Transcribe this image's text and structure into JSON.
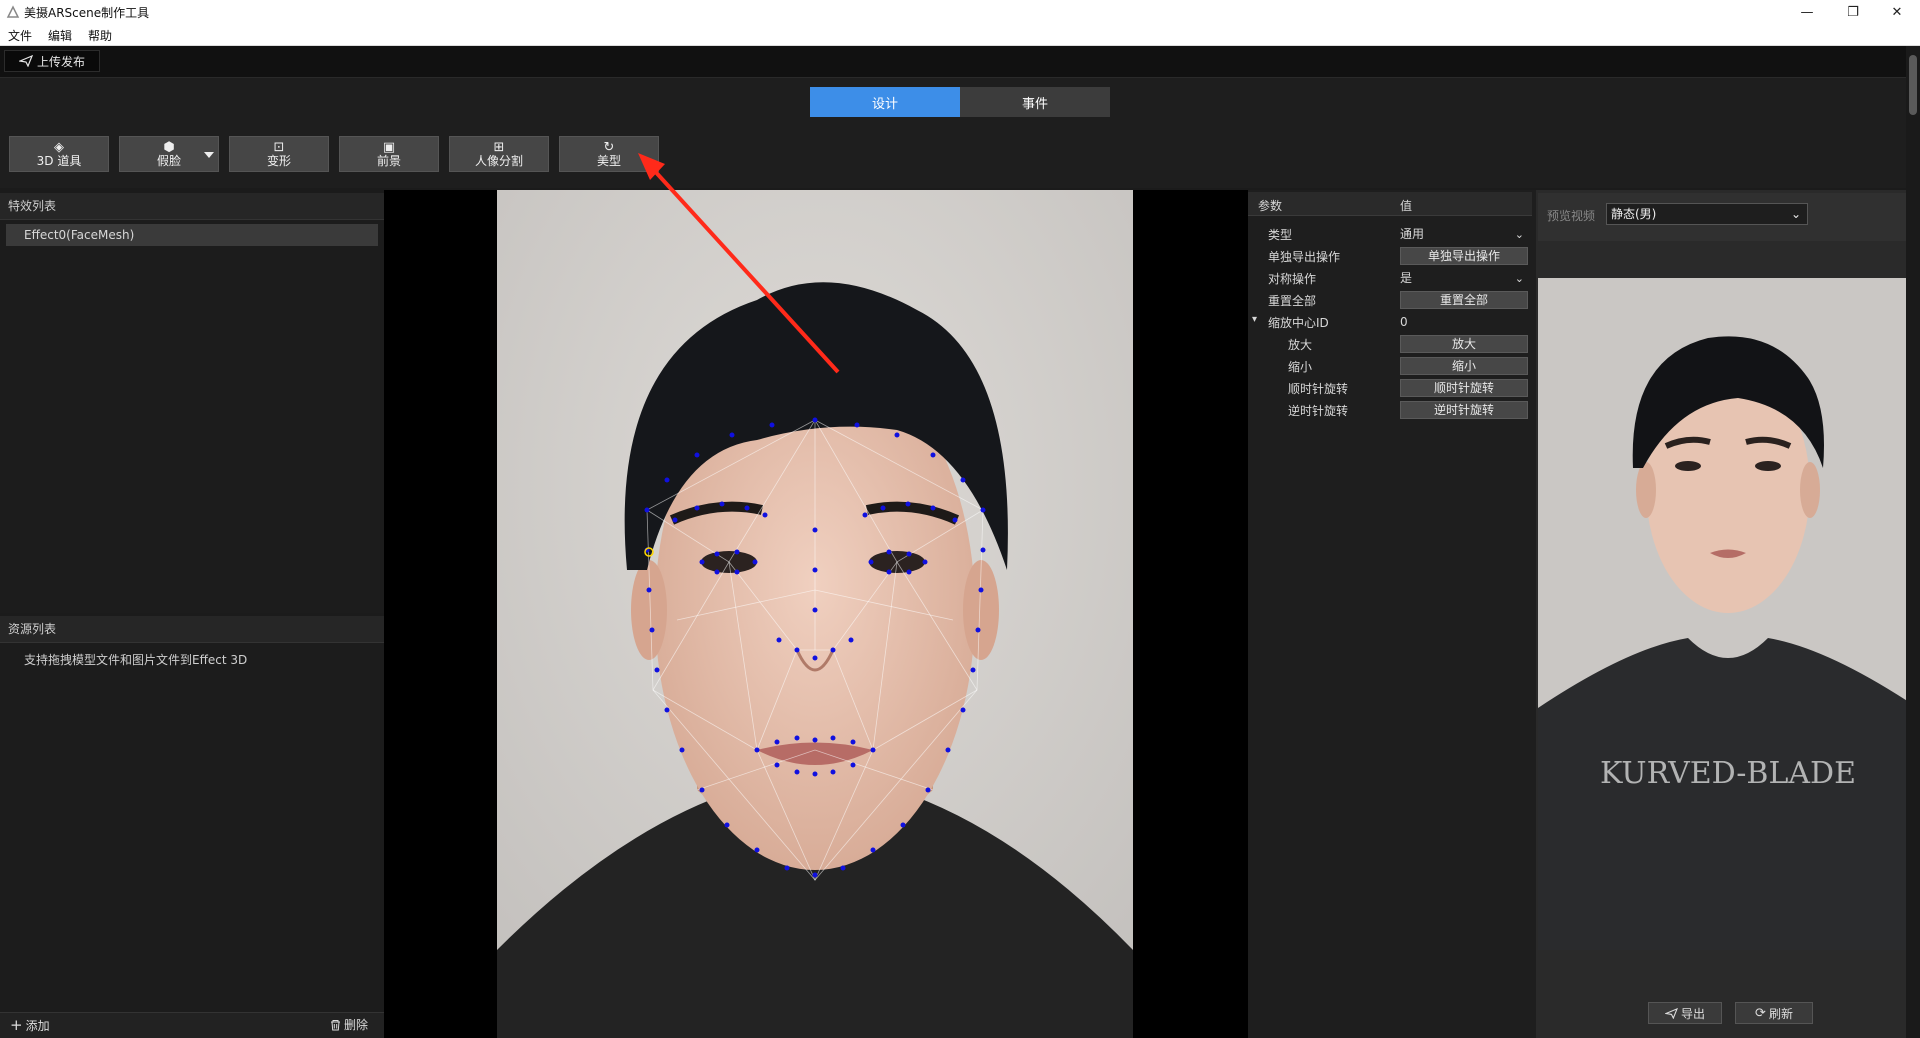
{
  "window": {
    "title": "美摄ARScene制作工具",
    "minimize_glyph": "—",
    "maximize_glyph": "❐",
    "close_glyph": "✕"
  },
  "menu": [
    "文件",
    "编辑",
    "帮助"
  ],
  "toolbar": {
    "publish_label": "上传发布",
    "publish_icon": "send-icon"
  },
  "tabs": [
    {
      "label": "设计",
      "active": true
    },
    {
      "label": "事件",
      "active": false
    }
  ],
  "tools": [
    {
      "label": "3D 道具",
      "icon": "cube-icon",
      "glyph": "◈"
    },
    {
      "label": "假脸",
      "icon": "mask-icon",
      "glyph": "⬢",
      "has_dropdown": true
    },
    {
      "label": "变形",
      "icon": "warp-icon",
      "glyph": "⊡"
    },
    {
      "label": "前景",
      "icon": "image-icon",
      "glyph": "▣"
    },
    {
      "label": "人像分割",
      "icon": "portrait-icon",
      "glyph": "⊞"
    },
    {
      "label": "美型",
      "icon": "refresh-icon",
      "glyph": "↻"
    }
  ],
  "effects_panel": {
    "title": "特效列表",
    "items": [
      "Effect0(FaceMesh)"
    ]
  },
  "resources_panel": {
    "title": "资源列表",
    "hint": "支持拖拽模型文件和图片文件到Effect 3D"
  },
  "bottom_bar": {
    "add_label": "添加",
    "delete_label": "删除"
  },
  "properties": {
    "col_param": "参数",
    "col_value": "值",
    "rows": [
      {
        "name": "类型",
        "value": "通用",
        "kind": "select"
      },
      {
        "name": "单独导出操作",
        "value": "单独导出操作",
        "kind": "button"
      },
      {
        "name": "对称操作",
        "value": "是",
        "kind": "select"
      },
      {
        "name": "重置全部",
        "value": "重置全部",
        "kind": "button"
      },
      {
        "name": "缩放中心ID",
        "value": "0",
        "kind": "text",
        "expanded": true
      },
      {
        "name": "放大",
        "value": "放大",
        "kind": "button",
        "child": true
      },
      {
        "name": "缩小",
        "value": "缩小",
        "kind": "button",
        "child": true
      },
      {
        "name": "顺时针旋转",
        "value": "顺时针旋转",
        "kind": "button",
        "child": true
      },
      {
        "name": "逆时针旋转",
        "value": "逆时针旋转",
        "kind": "button",
        "child": true
      }
    ]
  },
  "preview": {
    "label": "预览视频",
    "selected": "静态(男)",
    "export_label": "导出",
    "refresh_label": "刷新",
    "shirt_print": "KURVED-BLADE"
  },
  "colors": {
    "accent": "#3d8ee8",
    "arrow": "#ff2a1a",
    "landmark": "#1010e0"
  }
}
